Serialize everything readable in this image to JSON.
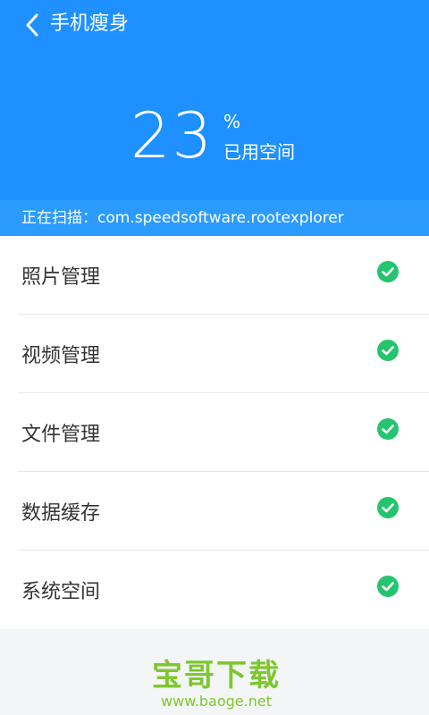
{
  "header": {
    "title": "手机瘦身",
    "usage_value": "23",
    "usage_unit": "%",
    "usage_label": "已用空间",
    "bg_color": "#1e90ff"
  },
  "scan": {
    "prefix": "正在扫描：",
    "target": "com.speedsoftware.rootexplorer"
  },
  "categories": [
    {
      "label": "照片管理",
      "status_icon": "check-circle-icon",
      "status_color": "#25c46e"
    },
    {
      "label": "视频管理",
      "status_icon": "check-circle-icon",
      "status_color": "#25c46e"
    },
    {
      "label": "文件管理",
      "status_icon": "check-circle-icon",
      "status_color": "#25c46e"
    },
    {
      "label": "数据缓存",
      "status_icon": "check-circle-icon",
      "status_color": "#25c46e"
    },
    {
      "label": "系统空间",
      "status_icon": "check-circle-icon",
      "status_color": "#25c46e"
    }
  ],
  "watermark": {
    "title": "宝哥下载",
    "site": "www.baoge.net"
  }
}
